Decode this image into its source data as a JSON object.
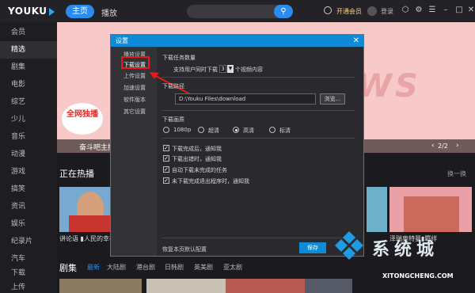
{
  "app": {
    "logo": "YOUKU"
  },
  "topbar": {
    "nav_home": "主页",
    "nav_play": "播放",
    "search_icon": "search-icon",
    "vip_label": "开通会员",
    "login_label": "登录"
  },
  "sidebar": {
    "items": [
      "会员",
      "精选",
      "剧集",
      "电影",
      "综艺",
      "少儿",
      "音乐",
      "动漫",
      "游戏",
      "搞笑",
      "资讯",
      "娱乐",
      "纪录片",
      "汽车",
      "下载",
      "上传"
    ],
    "active_index": 1
  },
  "banner": {
    "big_text": "GET INTERVIEWS",
    "badge": "全网独播",
    "caption": "奋斗吧主播",
    "page_indicator": "2/2"
  },
  "hot": {
    "title": "正在热播",
    "change": "换一换",
    "cards": [
      {
        "caption": "讲论语 ▮人民的幸福"
      },
      {
        "caption": ""
      },
      {
        "caption": ""
      },
      {
        "caption": "泽瑞奥特曼▮羁绊"
      }
    ]
  },
  "series": {
    "title": "剧集",
    "tabs": [
      "最新",
      "大陆剧",
      "港台剧",
      "日韩剧",
      "英美剧",
      "亚太剧"
    ],
    "active_tab": 0
  },
  "dialog": {
    "title": "设置",
    "close": "✕",
    "nav": [
      "播放设置",
      "下载设置",
      "上传设置",
      "加速设置",
      "软件版本",
      "其它设置"
    ],
    "active_nav": 1,
    "task_count_label": "下载任务数量",
    "task_count_prefix": "支持用户同时下载",
    "task_count_value": "3",
    "task_count_suffix": "个视频内容",
    "path_label": "下载路径",
    "path_value": "D:\\Youku Files\\download",
    "browse_label": "浏览...",
    "quality_label": "下载画质",
    "quality_options": [
      "1080p",
      "超清",
      "高清",
      "标清"
    ],
    "quality_selected": 2,
    "checkboxes": [
      {
        "label": "下载完成后，通知我",
        "checked": true
      },
      {
        "label": "下载出错时，通知我",
        "checked": true
      },
      {
        "label": "自动下载未完成的任务",
        "checked": true
      },
      {
        "label": "未下载完成退出程序时，通知我",
        "checked": true
      }
    ],
    "restore_label": "恢复本页默认配置",
    "save_label": "保存"
  },
  "watermark": {
    "cn": "系统城",
    "url": "XITONGCHENG.COM"
  },
  "colors": {
    "accent": "#0f8ad6",
    "highlight": "#e51a1a",
    "bg": "#1b1b1f"
  }
}
